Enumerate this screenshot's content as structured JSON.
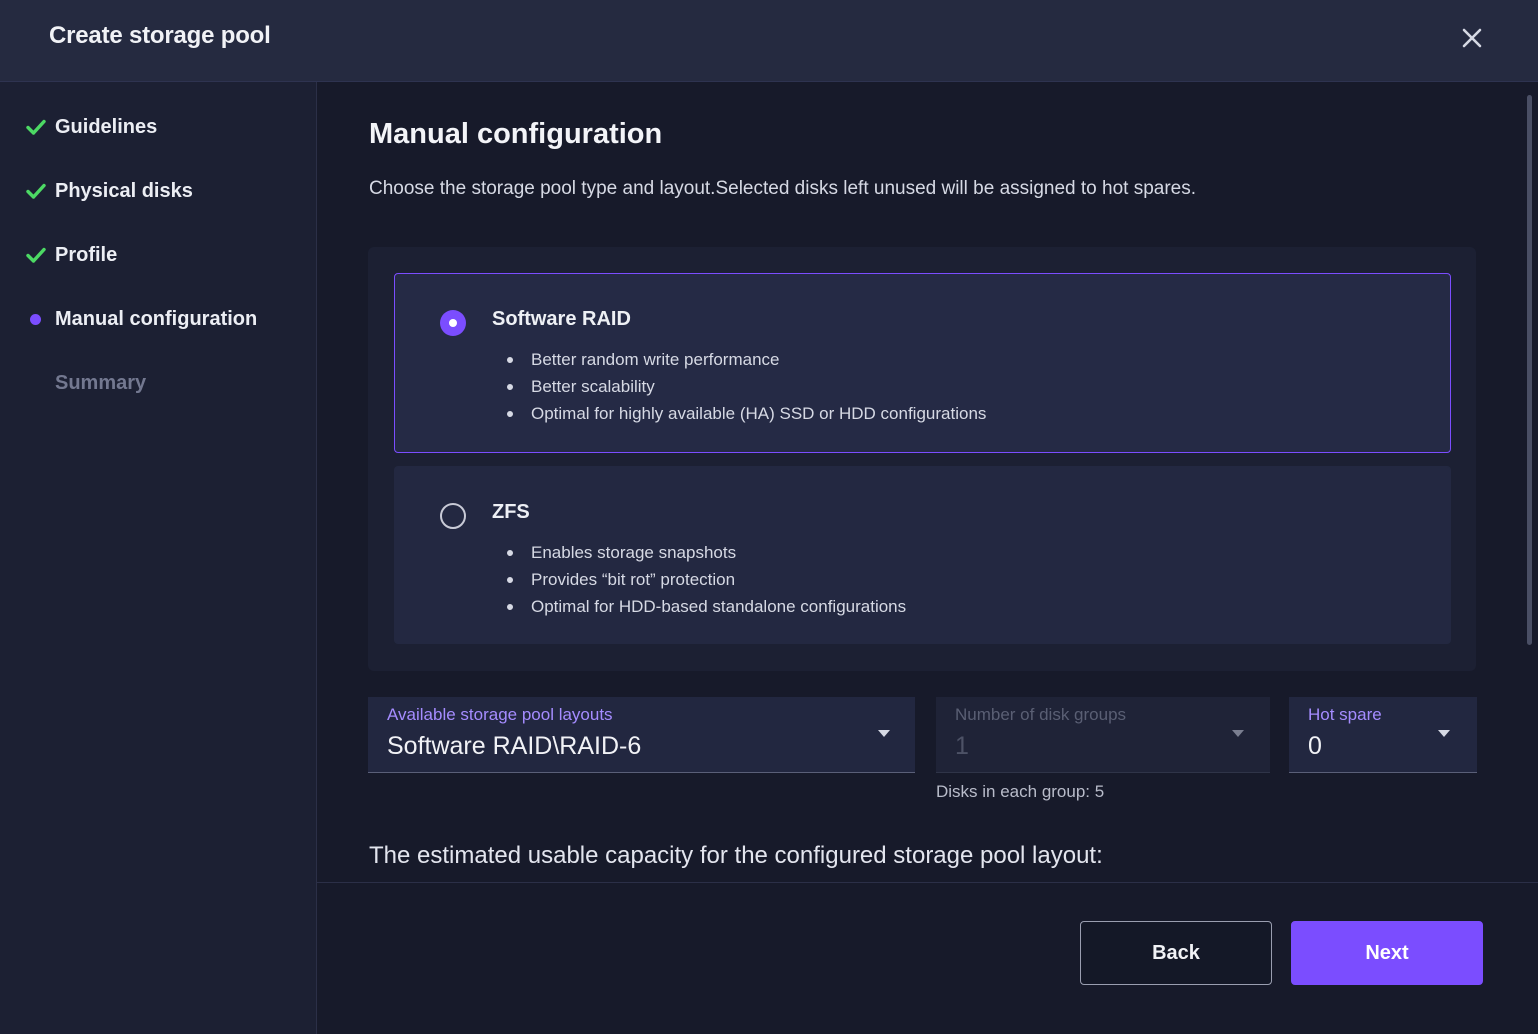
{
  "dialog": {
    "title": "Create storage pool",
    "close_icon": "close-icon"
  },
  "sidebar": {
    "steps": [
      {
        "label": "Guidelines",
        "status": "done",
        "icon": "check-icon"
      },
      {
        "label": "Physical disks",
        "status": "done",
        "icon": "check-icon"
      },
      {
        "label": "Profile",
        "status": "done",
        "icon": "check-icon"
      },
      {
        "label": "Manual configuration",
        "status": "current",
        "icon": "current-dot-icon"
      },
      {
        "label": "Summary",
        "status": "pending"
      }
    ]
  },
  "main": {
    "title": "Manual configuration",
    "description": "Choose the storage pool type and layout.Selected disks left unused will be assigned to hot spares.",
    "options": [
      {
        "name": "Software RAID",
        "selected": true,
        "bullets": [
          "Better random write performance",
          "Better scalability",
          "Optimal for highly available (HA) SSD or HDD configurations"
        ]
      },
      {
        "name": "ZFS",
        "selected": false,
        "bullets": [
          "Enables storage snapshots",
          "Provides “bit rot” protection",
          "Optimal for HDD-based standalone configurations"
        ]
      }
    ],
    "fields": {
      "layout": {
        "label": "Available storage pool layouts",
        "value": "Software RAID\\RAID-6"
      },
      "disk_groups": {
        "label": "Number of disk groups",
        "value": "1",
        "disabled": true
      },
      "hot_spare": {
        "label": "Hot spare",
        "value": "0"
      }
    },
    "hint": "Disks in each group: 5",
    "capacity_heading": "The estimated usable capacity for the configured storage pool layout:"
  },
  "footer": {
    "back_label": "Back",
    "next_label": "Next"
  },
  "colors": {
    "accent": "#7b4dff",
    "check": "#4cd964",
    "background": "#171a2a",
    "header": "#252a40"
  }
}
